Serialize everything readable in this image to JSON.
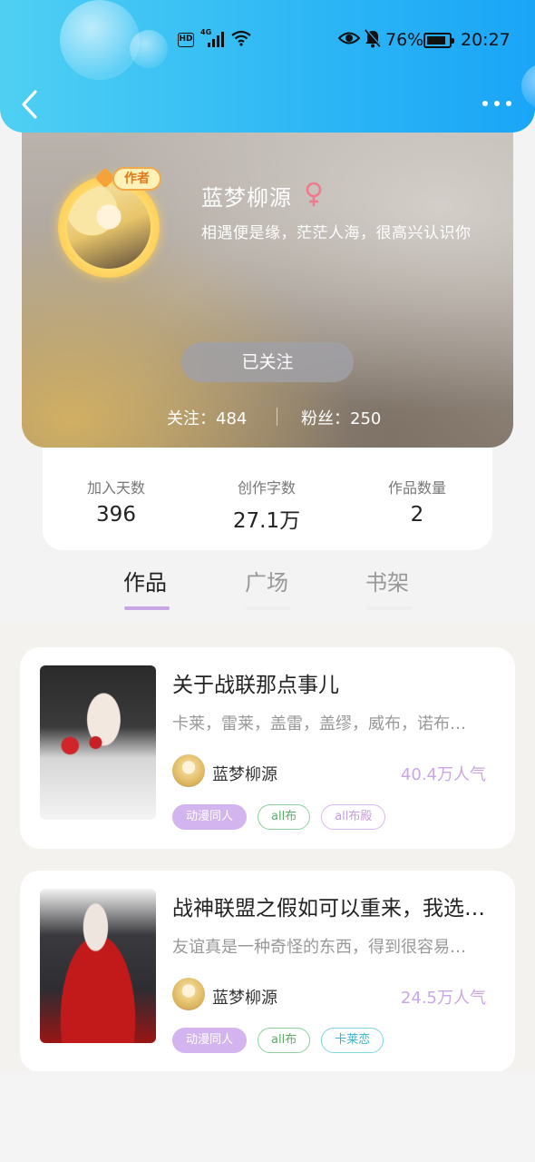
{
  "status_bar": {
    "hd": "HD",
    "network": "4G",
    "battery": "76%",
    "time": "20:27"
  },
  "profile": {
    "author_badge": "作者",
    "name": "蓝梦柳源",
    "gender_icon": "female-icon",
    "bio": "相遇便是缘，茫茫人海，很高兴认识你",
    "follow_button": "已关注",
    "following": "关注：484",
    "fans": "粉丝：250"
  },
  "stats": [
    {
      "label": "加入天数",
      "value": "396"
    },
    {
      "label": "创作字数",
      "value": "27.1万"
    },
    {
      "label": "作品数量",
      "value": "2"
    }
  ],
  "tabs": [
    {
      "label": "作品",
      "active": true
    },
    {
      "label": "广场",
      "active": false
    },
    {
      "label": "书架",
      "active": false
    }
  ],
  "works": [
    {
      "title": "关于战联那点事儿",
      "description": "卡莱，雷莱，盖雷，盖缪，威布，诺布…",
      "author": "蓝梦柳源",
      "popularity": "40.4万人气",
      "tags": [
        "动漫同人",
        "all布",
        "all布殿"
      ]
    },
    {
      "title": "战神联盟之假如可以重来，我选…",
      "description": "友谊真是一种奇怪的东西，得到很容易…",
      "author": "蓝梦柳源",
      "popularity": "24.5万人气",
      "tags": [
        "动漫同人",
        "all布",
        "卡莱恋"
      ]
    }
  ],
  "colors": {
    "header_start": "#4fd0f3",
    "header_end": "#1aa5f7",
    "accent_purple": "#c9a6e6",
    "popularity": "#caa6e6"
  }
}
